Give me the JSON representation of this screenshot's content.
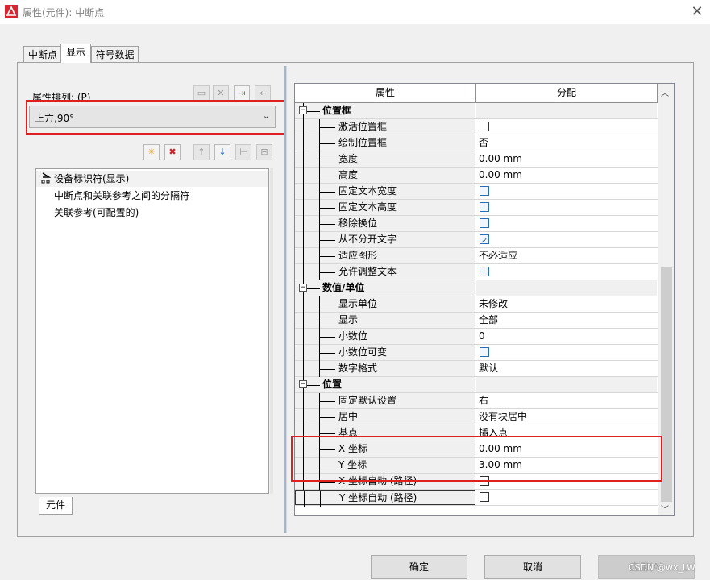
{
  "window": {
    "title": "属性(元件): 中断点",
    "close_glyph": "✕"
  },
  "tabs": [
    {
      "label": "中断点",
      "active": false
    },
    {
      "label": "显示",
      "active": true
    },
    {
      "label": "符号数据",
      "active": false
    }
  ],
  "left": {
    "sort_label": "属性排列: (P)",
    "sort_value": "上方,90°",
    "toolbar1_icons": [
      "save-icon",
      "delete-icon",
      "import-icon",
      "export-icon"
    ],
    "toolbar2_icons": [
      "new-icon",
      "remove-icon",
      "up-arrow-icon",
      "down-arrow-icon",
      "align-icon",
      "align2-icon"
    ],
    "list_items": [
      "设备标识符(显示)",
      "中断点和关联参考之间的分隔符",
      "关联参考(可配置的)"
    ],
    "bottom_tab": "元件"
  },
  "grid": {
    "col_property": "属性",
    "col_value": "分配",
    "rows": [
      {
        "type": "group",
        "label": "位置框"
      },
      {
        "type": "prop",
        "label": "激活位置框",
        "kind": "checkbox",
        "checked": false
      },
      {
        "type": "prop",
        "label": "绘制位置框",
        "kind": "text",
        "value": "否"
      },
      {
        "type": "prop",
        "label": "宽度",
        "kind": "text",
        "value": "0.00 mm"
      },
      {
        "type": "prop",
        "label": "高度",
        "kind": "text",
        "value": "0.00 mm"
      },
      {
        "type": "prop",
        "label": "固定文本宽度",
        "kind": "checkbox-blue",
        "checked": false
      },
      {
        "type": "prop",
        "label": "固定文本高度",
        "kind": "checkbox-blue",
        "checked": false
      },
      {
        "type": "prop",
        "label": "移除换位",
        "kind": "checkbox-blue",
        "checked": false
      },
      {
        "type": "prop",
        "label": "从不分开文字",
        "kind": "checkbox-blue",
        "checked": true
      },
      {
        "type": "prop",
        "label": "适应图形",
        "kind": "text",
        "value": "不必适应"
      },
      {
        "type": "prop",
        "label": "允许调整文本",
        "kind": "checkbox-blue",
        "checked": false
      },
      {
        "type": "group",
        "label": "数值/单位"
      },
      {
        "type": "prop",
        "label": "显示单位",
        "kind": "text",
        "value": "未修改"
      },
      {
        "type": "prop",
        "label": "显示",
        "kind": "text",
        "value": "全部"
      },
      {
        "type": "prop",
        "label": "小数位",
        "kind": "text",
        "value": "0"
      },
      {
        "type": "prop",
        "label": "小数位可变",
        "kind": "checkbox-blue",
        "checked": false
      },
      {
        "type": "prop",
        "label": "数字格式",
        "kind": "text",
        "value": "默认"
      },
      {
        "type": "group",
        "label": "位置"
      },
      {
        "type": "prop",
        "label": "固定默认设置",
        "kind": "text",
        "value": "右"
      },
      {
        "type": "prop",
        "label": "居中",
        "kind": "text",
        "value": "没有块居中"
      },
      {
        "type": "prop",
        "label": "基点",
        "kind": "text",
        "value": "插入点"
      },
      {
        "type": "prop",
        "label": "X 坐标",
        "kind": "text",
        "value": "0.00 mm"
      },
      {
        "type": "prop",
        "label": "Y 坐标",
        "kind": "text",
        "value": "3.00 mm"
      },
      {
        "type": "prop",
        "label": "X 坐标自动 (路径)",
        "kind": "checkbox",
        "checked": false
      },
      {
        "type": "prop",
        "label": "Y 坐标自动 (路径)",
        "kind": "checkbox",
        "checked": false
      }
    ]
  },
  "buttons": {
    "ok": "确定",
    "cancel": "取消",
    "apply": "应用(A)"
  },
  "watermark": "CSDN @wx_LW",
  "colors": {
    "highlight_border": "#e02020",
    "checkbox_blue": "#2a6db5"
  }
}
